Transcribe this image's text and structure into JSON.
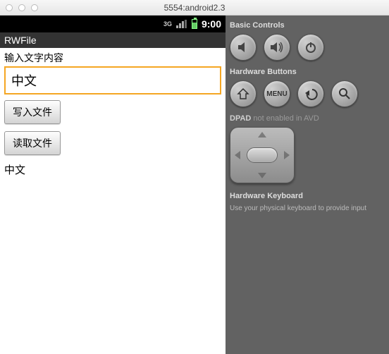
{
  "host_window": {
    "title": "5554:android2.3"
  },
  "device": {
    "status_bar": {
      "network_label": "3G",
      "time": "9:00"
    },
    "app_title": "RWFile",
    "screen": {
      "input_label": "输入文字内容",
      "input_value": "中文",
      "write_button_label": "写入文件",
      "read_button_label": "读取文件",
      "output_text": "中文"
    }
  },
  "controls_panel": {
    "basic_heading": "Basic Controls",
    "basic_buttons": {
      "vol_down": "vol-down",
      "vol_up": "vol-up",
      "power": "power"
    },
    "hardware_heading": "Hardware Buttons",
    "hardware_buttons": {
      "home": "home",
      "menu_label": "MENU",
      "back": "back",
      "search": "search"
    },
    "dpad_heading": "DPAD",
    "dpad_note": "not enabled in AVD",
    "keyboard_heading": "Hardware Keyboard",
    "keyboard_note": "Use your physical keyboard to provide input"
  }
}
